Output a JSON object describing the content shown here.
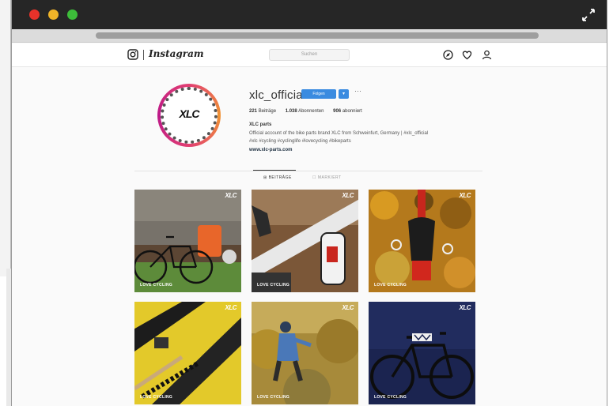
{
  "header": {
    "wordmark": "Instagram",
    "search_placeholder": "Suchen"
  },
  "profile": {
    "username": "xlc_official",
    "avatar_text": "XLC",
    "follow_label": "Folgen",
    "drop_label": "▾",
    "more_label": "···",
    "stats": {
      "posts": "221",
      "posts_label": "Beiträge",
      "followers": "1.038",
      "followers_label": "Abonnenten",
      "following": "906",
      "following_label": "abonniert"
    },
    "bio_name": "XLC parts",
    "bio_line1": "Official account of the bike parts brand XLC from Schweinfurt, Germany | #xlc_official",
    "bio_line2": "#xlc #cycling #cyclinglife #lovecycling #bikeparts",
    "bio_link": "www.xlc-parts.com"
  },
  "tabs": [
    {
      "label": "⊞ BEITRÄGE"
    },
    {
      "label": "☐ MARKIERT"
    }
  ],
  "grid": {
    "brand": "XLC",
    "tags": [
      "LOVE CYCLING",
      "LOVE CYCLING",
      "LOVE CYCLING",
      "LOVE CYCLING",
      "LOVE CYCLING",
      "LOVE CYCLING"
    ]
  },
  "colors": {
    "titlebar": "#262626",
    "close": "#e8322a",
    "minimize": "#f0b428",
    "maximize": "#3dbd3a",
    "follow": "#3a8be0"
  }
}
